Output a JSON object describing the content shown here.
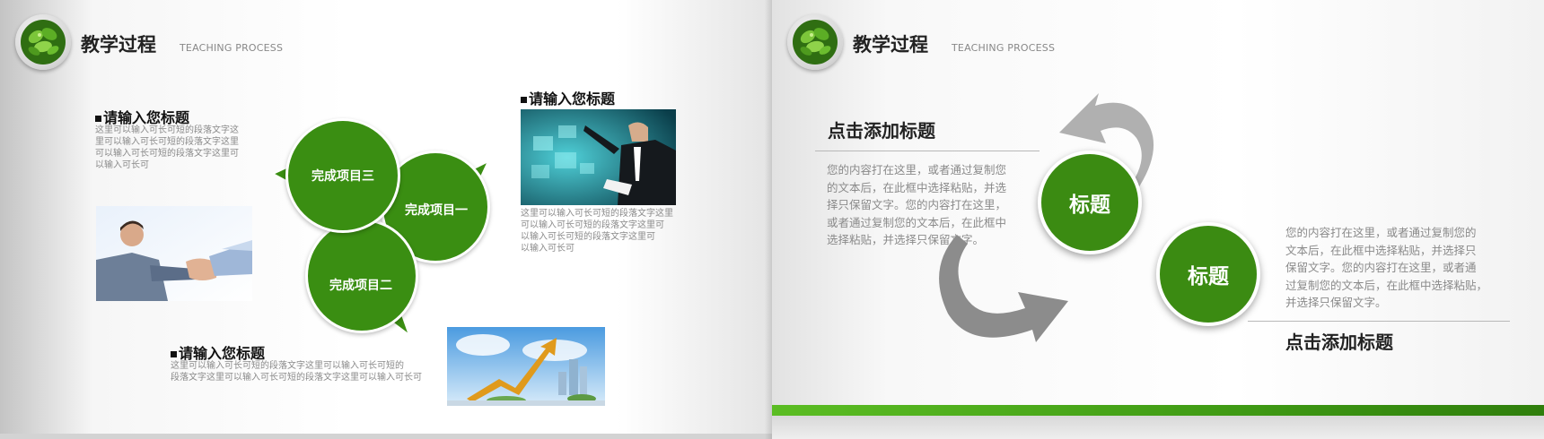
{
  "left_slide": {
    "header": {
      "title": "教学过程",
      "subtitle": "TEACHING PROCESS",
      "logo_icon": "leaf-plant-icon"
    },
    "block_top_left": {
      "title": "请输入您标题",
      "text": [
        "这里可以输入可长可短的段落文字这",
        "里可以输入可长可短的段落文字这里",
        "可以输入可长可短的段落文字这里可",
        "以输入可长可"
      ]
    },
    "block_top_right": {
      "title": "请输入您标题",
      "text": [
        "这里可以输入可长可短的段落文字这里",
        "可以输入可长可短的段落文字这里可",
        "以输入可长可短的段落文字这里可",
        "以输入可长可"
      ]
    },
    "block_bottom": {
      "title": "请输入您标题",
      "text": [
        "这里可以输入可长可短的段落文字这里可以输入可长可短的",
        "段落文字这里可以输入可长可短的段落文字这里可以输入可长可"
      ]
    },
    "bubbles": [
      "完成项目三",
      "完成项目一",
      "完成项目二"
    ],
    "images": [
      "handshake-photo",
      "businessman-touchscreen-photo",
      "growth-arrow-photo"
    ]
  },
  "right_slide": {
    "header": {
      "title": "教学过程",
      "subtitle": "TEACHING PROCESS",
      "logo_icon": "leaf-plant-icon"
    },
    "title_1": "点击添加标题",
    "text_1": [
      "您的内容打在这里，或者通过复制您",
      "的文本后，在此框中选择粘贴，并选",
      "择只保留文字。您的内容打在这里，",
      "或者通过复制您的文本后，在此框中",
      "选择粘贴，并选择只保留文字。"
    ],
    "circle_1": "标题",
    "circle_2": "标题",
    "text_2": [
      "您的内容打在这里，或者通过复制您的",
      "文本后，在此框中选择粘贴，并选择只",
      "保留文字。您的内容打在这里，或者通",
      "过复制您的文本后，在此框中选择粘贴，",
      "并选择只保留文字。"
    ],
    "title_2": "点击添加标题"
  },
  "colors": {
    "accent_green": "#3a8e12",
    "bar_green": "#4aa91b",
    "arrow_gray": "#a9a9a9"
  }
}
